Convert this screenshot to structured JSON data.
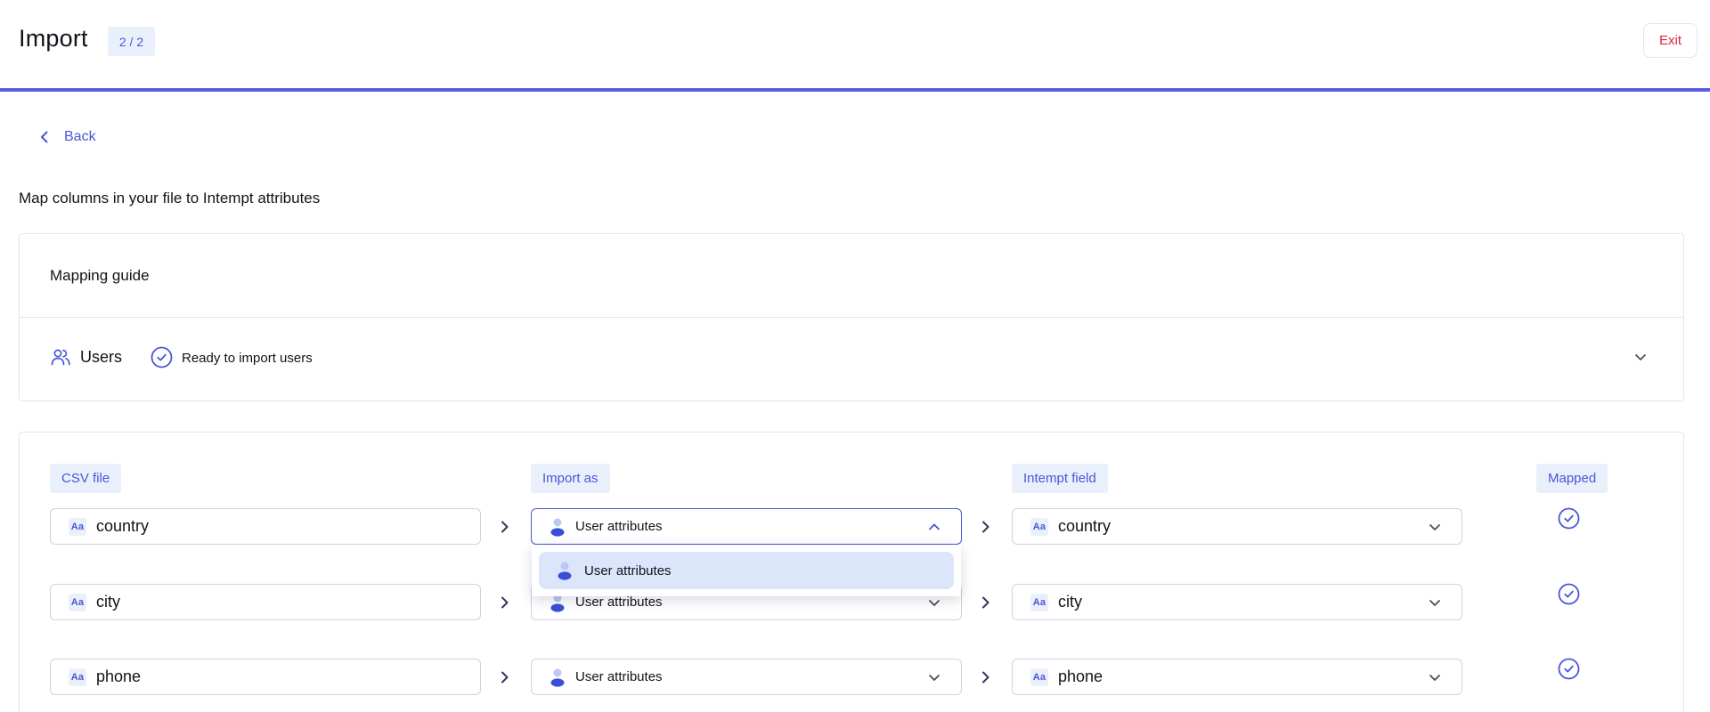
{
  "header": {
    "title": "Import",
    "step": "2 / 2",
    "exit_label": "Exit"
  },
  "nav": {
    "back_label": "Back"
  },
  "section_title": "Map columns in your file to Intempt attributes",
  "guide": {
    "title": "Mapping guide",
    "entity_label": "Users",
    "status_label": "Ready to import users"
  },
  "table": {
    "headers": {
      "csv_file": "CSV file",
      "import_as": "Import as",
      "intempt_field": "Intempt field",
      "mapped": "Mapped"
    },
    "rows": [
      {
        "csv": "country",
        "import_as": "User attributes",
        "field": "country",
        "mapped": true,
        "dropdown_open": true
      },
      {
        "csv": "city",
        "import_as": "User attributes",
        "field": "city",
        "mapped": true,
        "dropdown_open": false
      },
      {
        "csv": "phone",
        "import_as": "User attributes",
        "field": "phone",
        "mapped": true,
        "dropdown_open": false
      }
    ],
    "dropdown_options": [
      "User attributes"
    ]
  },
  "colors": {
    "accent": "#4a55d8",
    "progress": "#5b5ce6",
    "exit": "#e0203d",
    "badge_bg": "#eaf0fb",
    "selected_option_bg": "#dce6fb"
  },
  "icons": {
    "back": "chevron-left-icon",
    "users": "users-icon",
    "status": "check-circle-icon",
    "expand": "chevron-down-icon",
    "text_type": "text-type-icon",
    "import_type": "person-icon",
    "arrow": "chevron-right-icon"
  }
}
